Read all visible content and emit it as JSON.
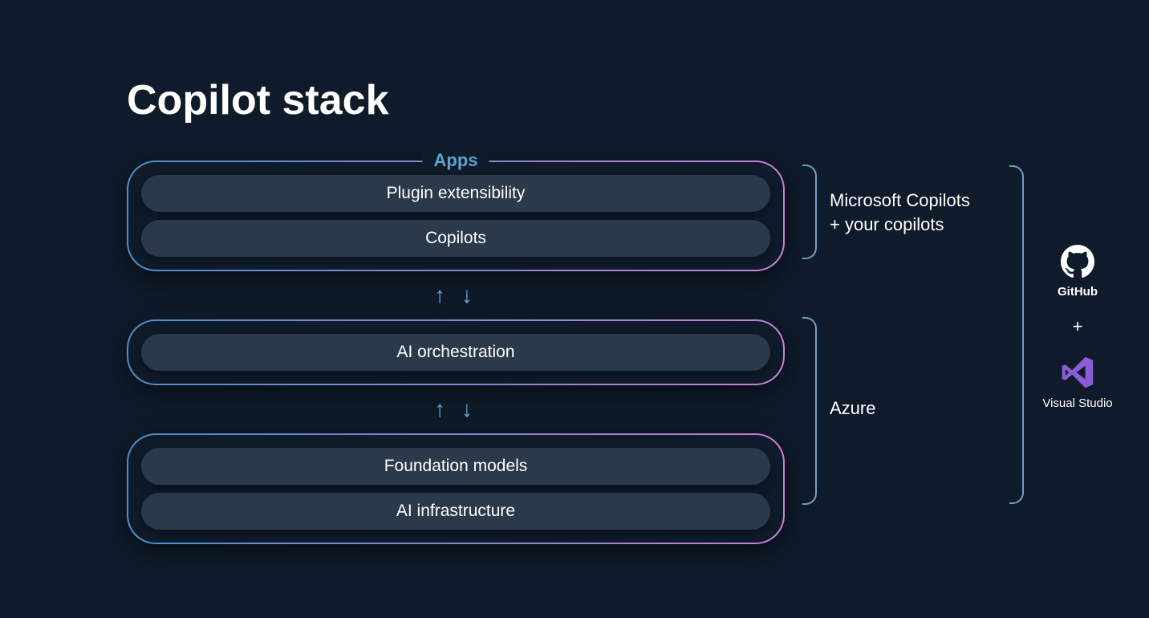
{
  "title": "Copilot stack",
  "groups": {
    "apps": {
      "label": "Apps",
      "items": [
        "Plugin extensibility",
        "Copilots"
      ]
    },
    "orchestration": {
      "items": [
        "AI orchestration"
      ]
    },
    "foundation": {
      "items": [
        "Foundation models",
        "AI infrastructure"
      ]
    }
  },
  "annotations": {
    "apps_bracket": "Microsoft Copilots\n+ your copilots",
    "azure_bracket": "Azure"
  },
  "tools": {
    "github": "GitHub",
    "plus": "+",
    "vs": "Visual Studio"
  },
  "arrows": "↑ ↓"
}
